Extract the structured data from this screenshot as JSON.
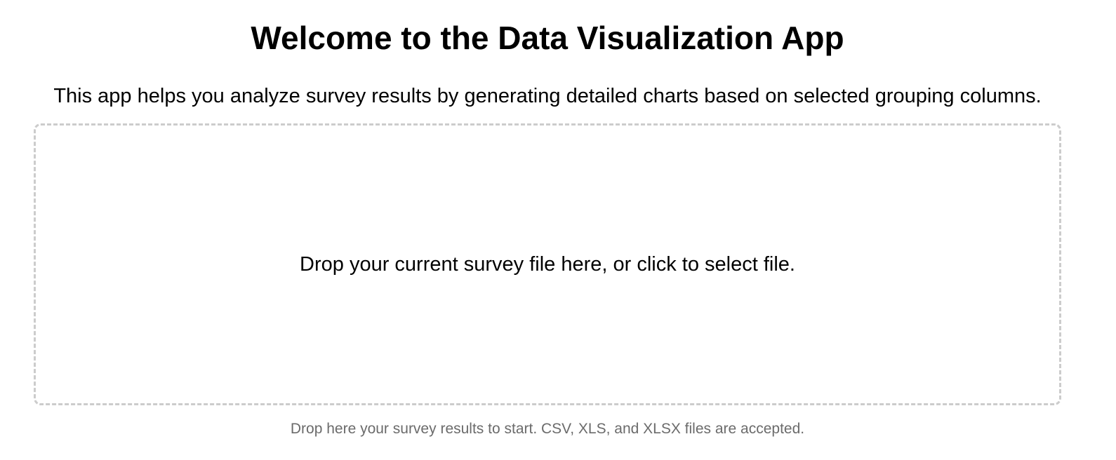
{
  "header": {
    "title": "Welcome to the Data Visualization App",
    "description": "This app helps you analyze survey results by generating detailed charts based on selected grouping columns."
  },
  "upload": {
    "dropzone_text": "Drop your current survey file here, or click to select file.",
    "hint_text": "Drop here your survey results to start. CSV, XLS, and XLSX files are accepted."
  },
  "colors": {
    "text": "#000000",
    "hint_text": "#6b6b6b",
    "dropzone_border": "#cccccc",
    "background": "#ffffff"
  }
}
